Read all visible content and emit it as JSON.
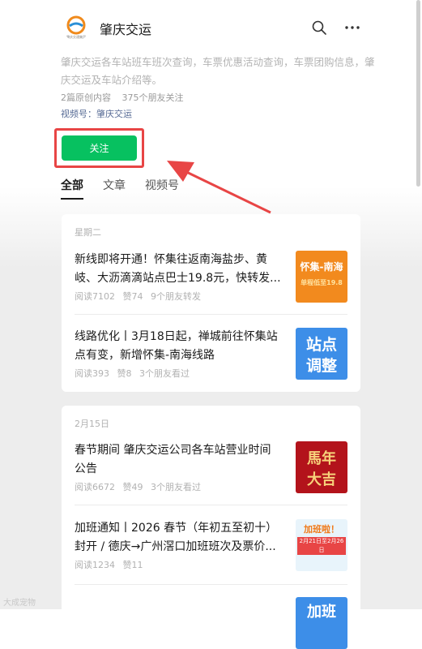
{
  "header": {
    "title": "肇庆交运",
    "logo_text": "肇庆交通集团"
  },
  "profile": {
    "description": "肇庆交运各车站班车班次查询，车票优惠活动查询，车票团购信息，肇庆交运及车站介绍等。",
    "original_count": "2篇原创内容",
    "friends_follow": "375个朋友关注",
    "channel": "视频号：肇庆交运",
    "follow_label": "关注"
  },
  "tabs": [
    {
      "label": "全部"
    },
    {
      "label": "文章"
    },
    {
      "label": "视频号"
    }
  ],
  "groups": [
    {
      "date": "星期二",
      "articles": [
        {
          "title": "新线即将开通！怀集往返南海盐步、黄岐、大沥滴滴站点巴士19.8元，快转发...",
          "reads": "阅读7102",
          "likes": "赞74",
          "social": "9个朋友转发",
          "thumb_main": "怀集-南海",
          "thumb_sub": "单程低至19.8"
        },
        {
          "title": "线路优化丨3月18日起，禅城前往怀集站点有变，新增怀集-南海线路",
          "reads": "阅读393",
          "likes": "赞8",
          "social": "3个朋友看过",
          "thumb_main": "站点",
          "thumb_sub": "调整"
        }
      ]
    },
    {
      "date": "2月15日",
      "articles": [
        {
          "title": "春节期间 肇庆交运公司各车站营业时间公告",
          "reads": "阅读6672",
          "likes": "赞49",
          "social": "3个朋友看过",
          "thumb_main": "馬年",
          "thumb_sub": "大吉"
        },
        {
          "title": "加班通知丨2026 春节（年初五至初十）封开 / 德庆→广州滘口加班班次及票价...",
          "reads": "阅读1234",
          "likes": "赞11",
          "social": "",
          "thumb_main": "加班啦！",
          "thumb_sub": "2月21日至2月26日"
        }
      ]
    }
  ],
  "partial_thumb": "加班",
  "watermark": "大成宠物",
  "colors": {
    "follow": "#07c160",
    "highlight": "#e84545",
    "link": "#576b95"
  }
}
